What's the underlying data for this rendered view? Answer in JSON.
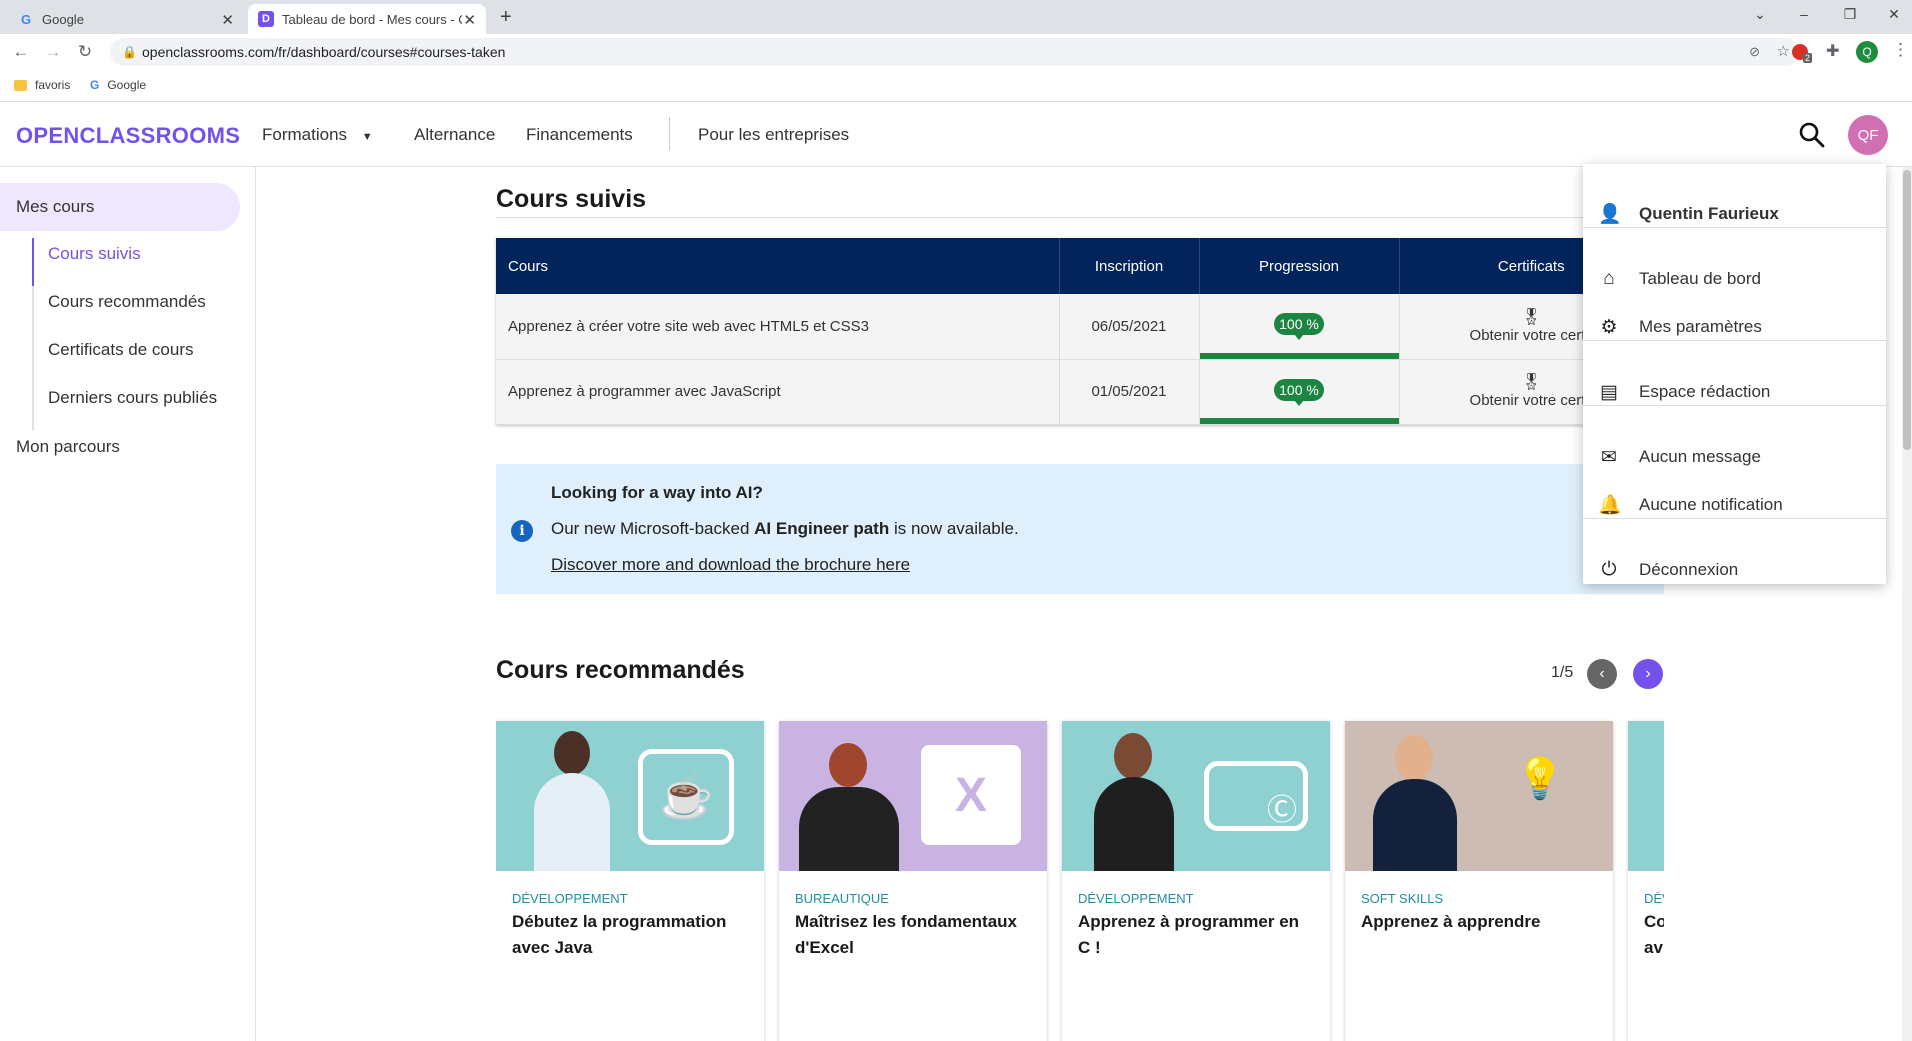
{
  "browser": {
    "tabs": [
      {
        "title": "Google",
        "favicon": "G"
      },
      {
        "title": "Tableau de bord - Mes cours - O",
        "favicon": "D"
      }
    ],
    "url": "openclassrooms.com/fr/dashboard/courses#courses-taken",
    "bookmarks": [
      {
        "label": "favoris"
      },
      {
        "label": "Google"
      }
    ],
    "extension_badge": "2",
    "profile_initial": "Q"
  },
  "site": {
    "logo": "OPENCLASSROOMS",
    "nav": [
      "Formations",
      "Alternance",
      "Financements",
      "Pour les entreprises"
    ],
    "avatar_initials": "QF"
  },
  "sidebar": {
    "items": [
      {
        "label": "Mes cours",
        "active": true
      },
      {
        "label": "Cours suivis",
        "active": true
      },
      {
        "label": "Cours recommandés"
      },
      {
        "label": "Certificats de cours"
      },
      {
        "label": "Derniers cours publiés"
      },
      {
        "label": "Mon parcours"
      }
    ]
  },
  "courses_taken": {
    "title": "Cours suivis",
    "columns": [
      "Cours",
      "Inscription",
      "Progression",
      "Certificats"
    ],
    "rows": [
      {
        "course": "Apprenez à créer votre site web avec HTML5 et CSS3",
        "date": "06/05/2021",
        "progress": "100 %",
        "progress_fraction": 1.0,
        "certificate": "Obtenir votre certif"
      },
      {
        "course": "Apprenez à programmer avec JavaScript",
        "date": "01/05/2021",
        "progress": "100 %",
        "progress_fraction": 1.0,
        "certificate": "Obtenir votre certif"
      }
    ]
  },
  "banner": {
    "title": "Looking for a way into AI?",
    "text_before": "Our new Microsoft-backed ",
    "text_bold": "AI Engineer path",
    "text_after": " is now available.",
    "link": "Discover more and download the brochure here"
  },
  "recommended": {
    "title": "Cours recommandés",
    "pager": "1/5",
    "cards": [
      {
        "category": "Développement",
        "title": "Débutez la programmation avec Java",
        "bg": "#8fd1d1"
      },
      {
        "category": "Bureautique",
        "title": "Maîtrisez les fondamentaux d'Excel",
        "bg": "#c9b3e3"
      },
      {
        "category": "Développement",
        "title": "Apprenez à programmer en C !",
        "bg": "#8fd1d1"
      },
      {
        "category": "Soft skills",
        "title": "Apprenez à apprendre",
        "bg": "#cdbcb4"
      },
      {
        "category": "Dév",
        "title": "Co av",
        "bg": "#8fd1d1"
      }
    ]
  },
  "user_menu": {
    "name": "Quentin Faurieux",
    "items": [
      {
        "label": "Tableau de bord",
        "icon": "home-icon"
      },
      {
        "label": "Mes paramètres",
        "icon": "gear-icon"
      },
      {
        "label": "Espace rédaction",
        "icon": "document-icon"
      },
      {
        "label": "Aucun message",
        "icon": "mail-icon"
      },
      {
        "label": "Aucune notification",
        "icon": "bell-icon"
      },
      {
        "label": "Déconnexion",
        "icon": "power-icon"
      }
    ]
  },
  "colors": {
    "brand": "#7451eb",
    "table_header": "#02245b",
    "progress": "#1c8541",
    "avatar": "#d16fb3",
    "banner_bg": "#dff0fc"
  }
}
